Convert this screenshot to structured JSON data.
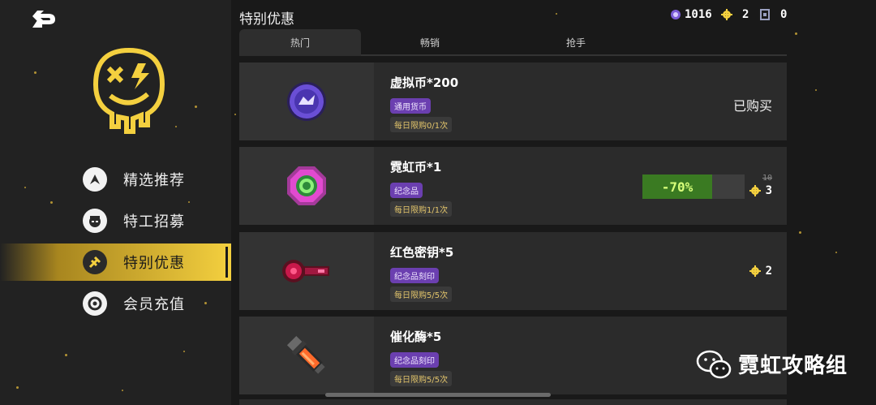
{
  "header": {
    "title": "特别优惠"
  },
  "currencies": [
    {
      "icon": "neon-coin-icon",
      "value": "1016"
    },
    {
      "icon": "gear-token-icon",
      "value": "2"
    },
    {
      "icon": "ticket-card-icon",
      "value": "0"
    }
  ],
  "tabs": [
    {
      "label": "热门",
      "active": true
    },
    {
      "label": "畅销",
      "active": false
    },
    {
      "label": "抢手",
      "active": false
    }
  ],
  "sidebar": {
    "items": [
      {
        "label": "精选推荐",
        "icon": "recommend-icon",
        "active": false
      },
      {
        "label": "特工招募",
        "icon": "agent-icon",
        "active": false
      },
      {
        "label": "特别优惠",
        "icon": "offer-icon",
        "active": true
      },
      {
        "label": "会员充值",
        "icon": "recharge-icon",
        "active": false
      }
    ]
  },
  "offers": [
    {
      "name": "虚拟币*200",
      "badge": "通用货币",
      "limit": "每日限购0/1次",
      "status": "已购买",
      "icon": "virtual-coin-icon"
    },
    {
      "name": "霓虹币*1",
      "badge": "纪念品",
      "limit": "每日限购1/1次",
      "discount": "-70%",
      "original_price": "10",
      "price": "3",
      "icon": "neon-coin-item-icon"
    },
    {
      "name": "红色密钥*5",
      "badge": "纪念品刻印",
      "limit": "每日限购5/5次",
      "price": "2",
      "icon": "red-key-icon"
    },
    {
      "name": "催化酶*5",
      "badge": "纪念品刻印",
      "limit": "每日限购5/5次",
      "icon": "catalyst-icon"
    }
  ],
  "watermark": {
    "text": "霓虹攻略组",
    "icon": "wechat-icon"
  },
  "colors": {
    "accent": "#f4d03f",
    "badge_purple": "#6b3fb0",
    "discount_green": "#3a7a22",
    "limit_gold": "#e3c56b"
  }
}
